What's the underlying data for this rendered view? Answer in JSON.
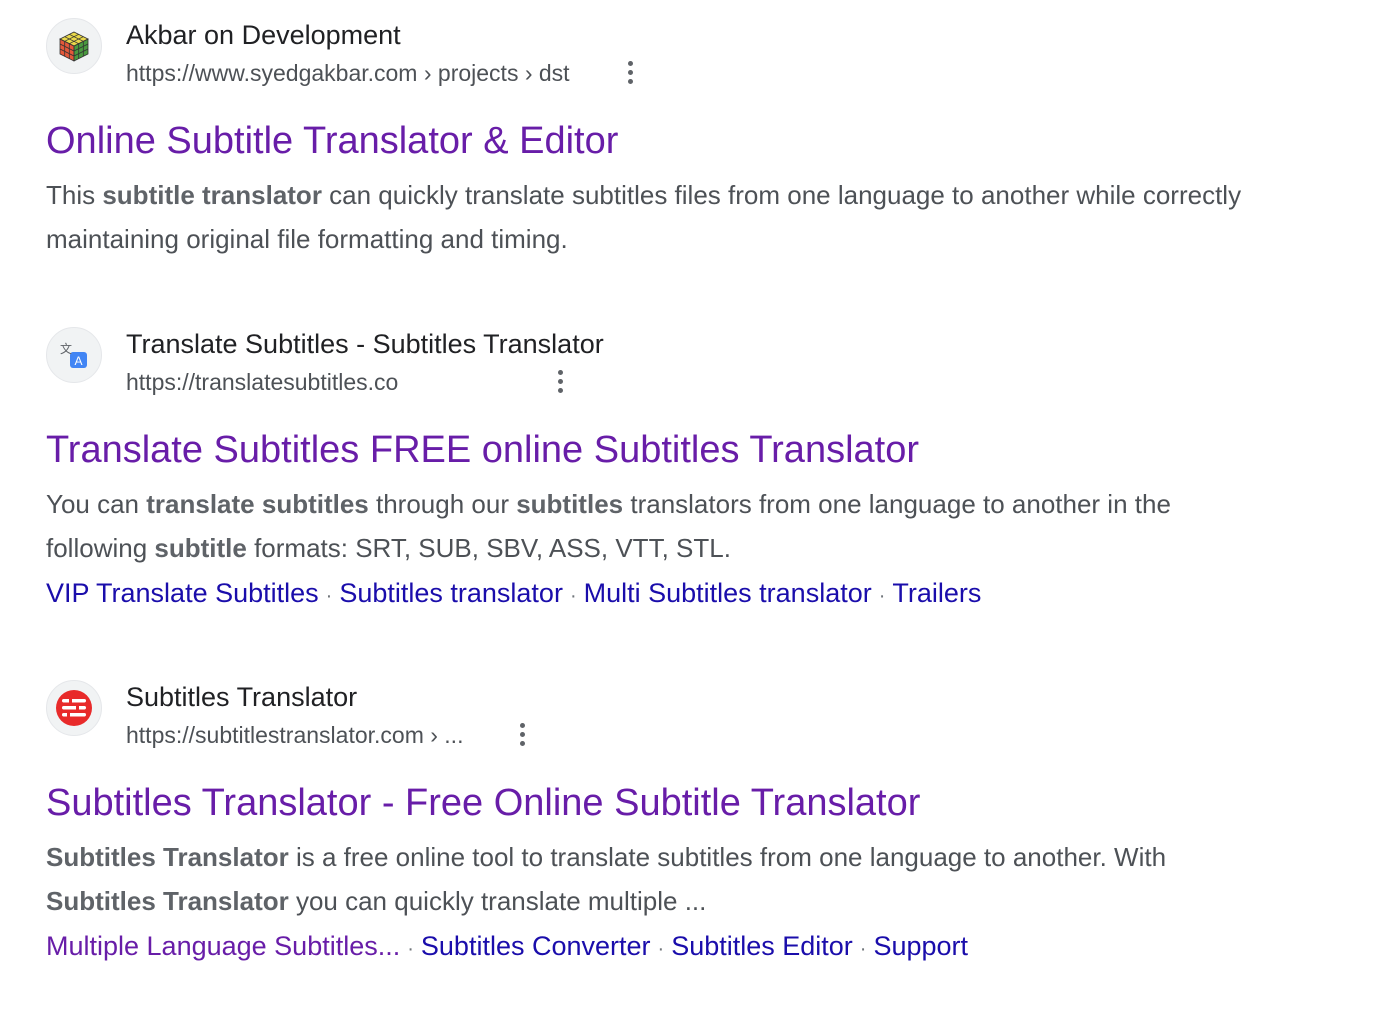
{
  "results": [
    {
      "site_name": "Akbar on Development",
      "url": "https://www.syedgakbar.com › projects › dst",
      "favicon": "rubiks-cube-icon",
      "title": "Online Subtitle Translator & Editor",
      "snippet": [
        {
          "text": "This ",
          "bold": false
        },
        {
          "text": "subtitle translator",
          "bold": true
        },
        {
          "text": " can quickly translate subtitles files from one language to another while correctly maintaining original file formatting and timing.",
          "bold": false
        }
      ],
      "sitelinks": []
    },
    {
      "site_name": "Translate Subtitles - Subtitles Translator",
      "url": "https://translatesubtitles.co",
      "favicon": "translate-icon",
      "title": "Translate Subtitles FREE online Subtitles Translator",
      "snippet": [
        {
          "text": "You can ",
          "bold": false
        },
        {
          "text": "translate subtitles",
          "bold": true
        },
        {
          "text": " through our ",
          "bold": false
        },
        {
          "text": "subtitles",
          "bold": true
        },
        {
          "text": " translators from one language to another in the following ",
          "bold": false
        },
        {
          "text": "subtitle",
          "bold": true
        },
        {
          "text": " formats: SRT, SUB, SBV, ASS, VTT, STL.",
          "bold": false
        }
      ],
      "sitelinks": [
        {
          "label": "VIP Translate Subtitles",
          "visited": false
        },
        {
          "label": "Subtitles translator",
          "visited": false
        },
        {
          "label": "Multi Subtitles translator",
          "visited": false
        },
        {
          "label": "Trailers",
          "visited": false
        }
      ]
    },
    {
      "site_name": "Subtitles Translator",
      "url": "https://subtitlestranslator.com › ...",
      "favicon": "subtitles-lines-icon",
      "title": "Subtitles Translator - Free Online Subtitle Translator",
      "snippet": [
        {
          "text": "Subtitles Translator",
          "bold": true
        },
        {
          "text": " is a free online tool to translate subtitles from one language to another. With ",
          "bold": false
        },
        {
          "text": "Subtitles Translator",
          "bold": true
        },
        {
          "text": " you can quickly translate multiple ...",
          "bold": false
        }
      ],
      "sitelinks": [
        {
          "label": "Multiple Language Subtitles...",
          "visited": true
        },
        {
          "label": "Subtitles Converter",
          "visited": false
        },
        {
          "label": "Subtitles Editor",
          "visited": false
        },
        {
          "label": "Support",
          "visited": false
        }
      ]
    }
  ],
  "separator": "·",
  "colors": {
    "title_visited": "#681da8",
    "link": "#1a0dab",
    "snippet": "#4d5156",
    "site_name": "#202124"
  }
}
